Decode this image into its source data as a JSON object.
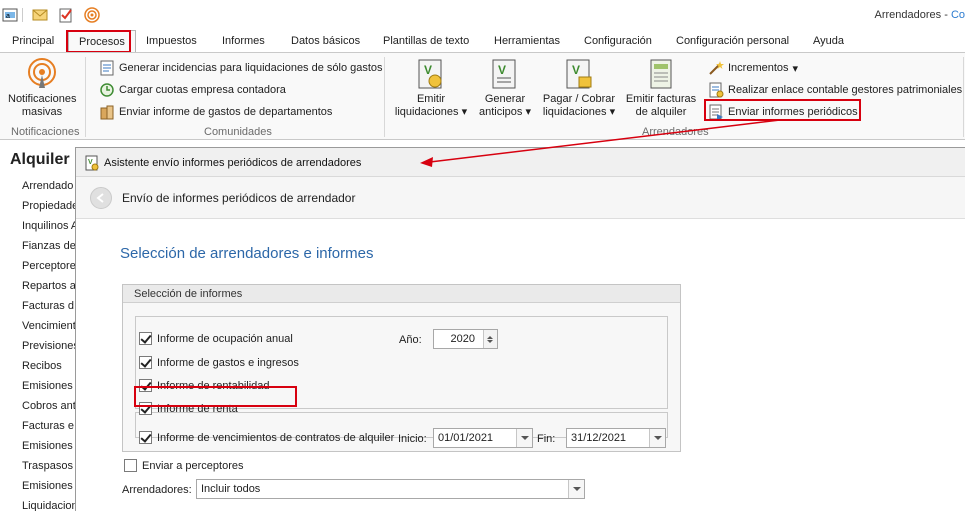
{
  "window": {
    "title": "Arrendadores - ",
    "title_accent": "Co"
  },
  "tabs": [
    "Principal",
    "Procesos",
    "Impuestos",
    "Informes",
    "Datos básicos",
    "Plantillas de texto",
    "Herramientas",
    "Configuración",
    "Configuración personal",
    "Ayuda"
  ],
  "active_tab": "Procesos",
  "ribbon": {
    "notificaciones": {
      "button_line1": "Notificaciones",
      "button_line2": "masivas",
      "group": "Notificaciones"
    },
    "comunidades": {
      "items": [
        "Generar incidencias para liquidaciones de sólo gastos",
        "Cargar cuotas empresa contadora",
        "Enviar informe de gastos de departamentos"
      ],
      "group": "Comunidades"
    },
    "arrendadores": {
      "big": [
        {
          "l1": "Emitir",
          "l2": "liquidaciones",
          "arrow": true
        },
        {
          "l1": "Generar",
          "l2": "anticipos",
          "arrow": true
        },
        {
          "l1": "Pagar / Cobrar",
          "l2": "liquidaciones",
          "arrow": true
        },
        {
          "l1": "Emitir facturas",
          "l2": "de alquiler",
          "arrow": false
        }
      ],
      "small": [
        "Incrementos",
        "Realizar enlace contable gestores patrimoniales",
        "Enviar informes periódicos"
      ],
      "group": "Arrendadores"
    }
  },
  "left_panel": {
    "title": "Alquiler",
    "items": [
      "Arrendado",
      "Propiedade",
      "Inquilinos A",
      "Fianzas de",
      "Perceptore",
      "Repartos a",
      "Facturas d",
      "Vencimient",
      "Previsiones",
      "Recibos",
      "Emisiones d",
      "Cobros ant",
      "Facturas e",
      "Emisiones d",
      "Traspasos",
      "Emisiones d",
      "Liquidacion"
    ]
  },
  "wizard": {
    "window_title": "Asistente envío informes periódicos de arrendadores",
    "page_title": "Envío de informes periódicos de arrendador",
    "heading": "Selección de arrendadores e informes",
    "group_title": "Selección de informes",
    "reports": [
      {
        "label": "Informe de ocupación anual",
        "checked": true
      },
      {
        "label": "Informe de gastos e ingresos",
        "checked": true
      },
      {
        "label": "Informe de rentabilidad",
        "checked": true
      },
      {
        "label": "Informe de renta",
        "checked": true
      }
    ],
    "year": {
      "label": "Año:",
      "value": "2020"
    },
    "vencimientos": {
      "label": "Informe de vencimientos de contratos de alquiler",
      "checked": true,
      "start_label": "Inicio:",
      "start": "01/01/2021",
      "end_label": "Fin:",
      "end": "31/12/2021"
    },
    "enviar_perceptores": {
      "label": "Enviar a perceptores",
      "checked": false
    },
    "arrendadores": {
      "label": "Arrendadores:",
      "value": "Incluir todos"
    }
  },
  "colors": {
    "annotation_red": "#d7000f",
    "heading_blue": "#2c67a8"
  }
}
